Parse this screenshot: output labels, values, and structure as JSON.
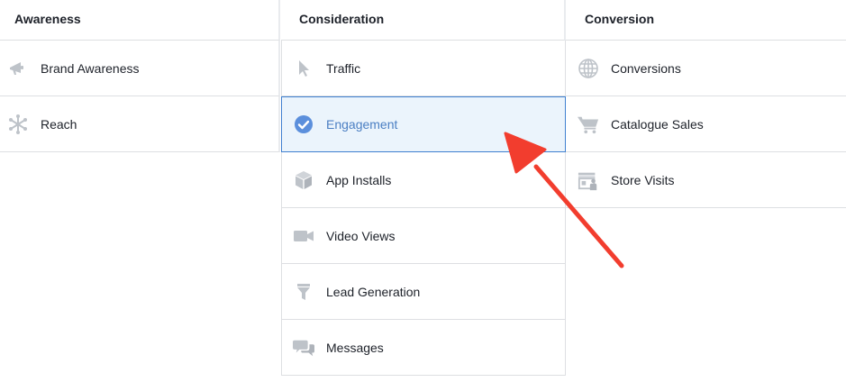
{
  "columns": {
    "awareness": {
      "title": "Awareness",
      "items": [
        {
          "label": "Brand Awareness",
          "icon": "megaphone-icon"
        },
        {
          "label": "Reach",
          "icon": "reach-icon"
        }
      ]
    },
    "consideration": {
      "title": "Consideration",
      "items": [
        {
          "label": "Traffic",
          "icon": "cursor-icon"
        },
        {
          "label": "Engagement",
          "icon": "check-circle-icon",
          "selected": true
        },
        {
          "label": "App Installs",
          "icon": "box-icon"
        },
        {
          "label": "Video Views",
          "icon": "video-camera-icon"
        },
        {
          "label": "Lead Generation",
          "icon": "funnel-icon"
        },
        {
          "label": "Messages",
          "icon": "chat-bubbles-icon"
        }
      ]
    },
    "conversion": {
      "title": "Conversion",
      "items": [
        {
          "label": "Conversions",
          "icon": "globe-icon"
        },
        {
          "label": "Catalogue Sales",
          "icon": "shopping-cart-icon"
        },
        {
          "label": "Store Visits",
          "icon": "store-icon"
        }
      ]
    }
  },
  "colors": {
    "icon_gray": "#bec3c9",
    "selected_blue": "#5b8fdc",
    "selected_bg": "#ebf4fc",
    "annotation_arrow": "#f23d2e"
  }
}
